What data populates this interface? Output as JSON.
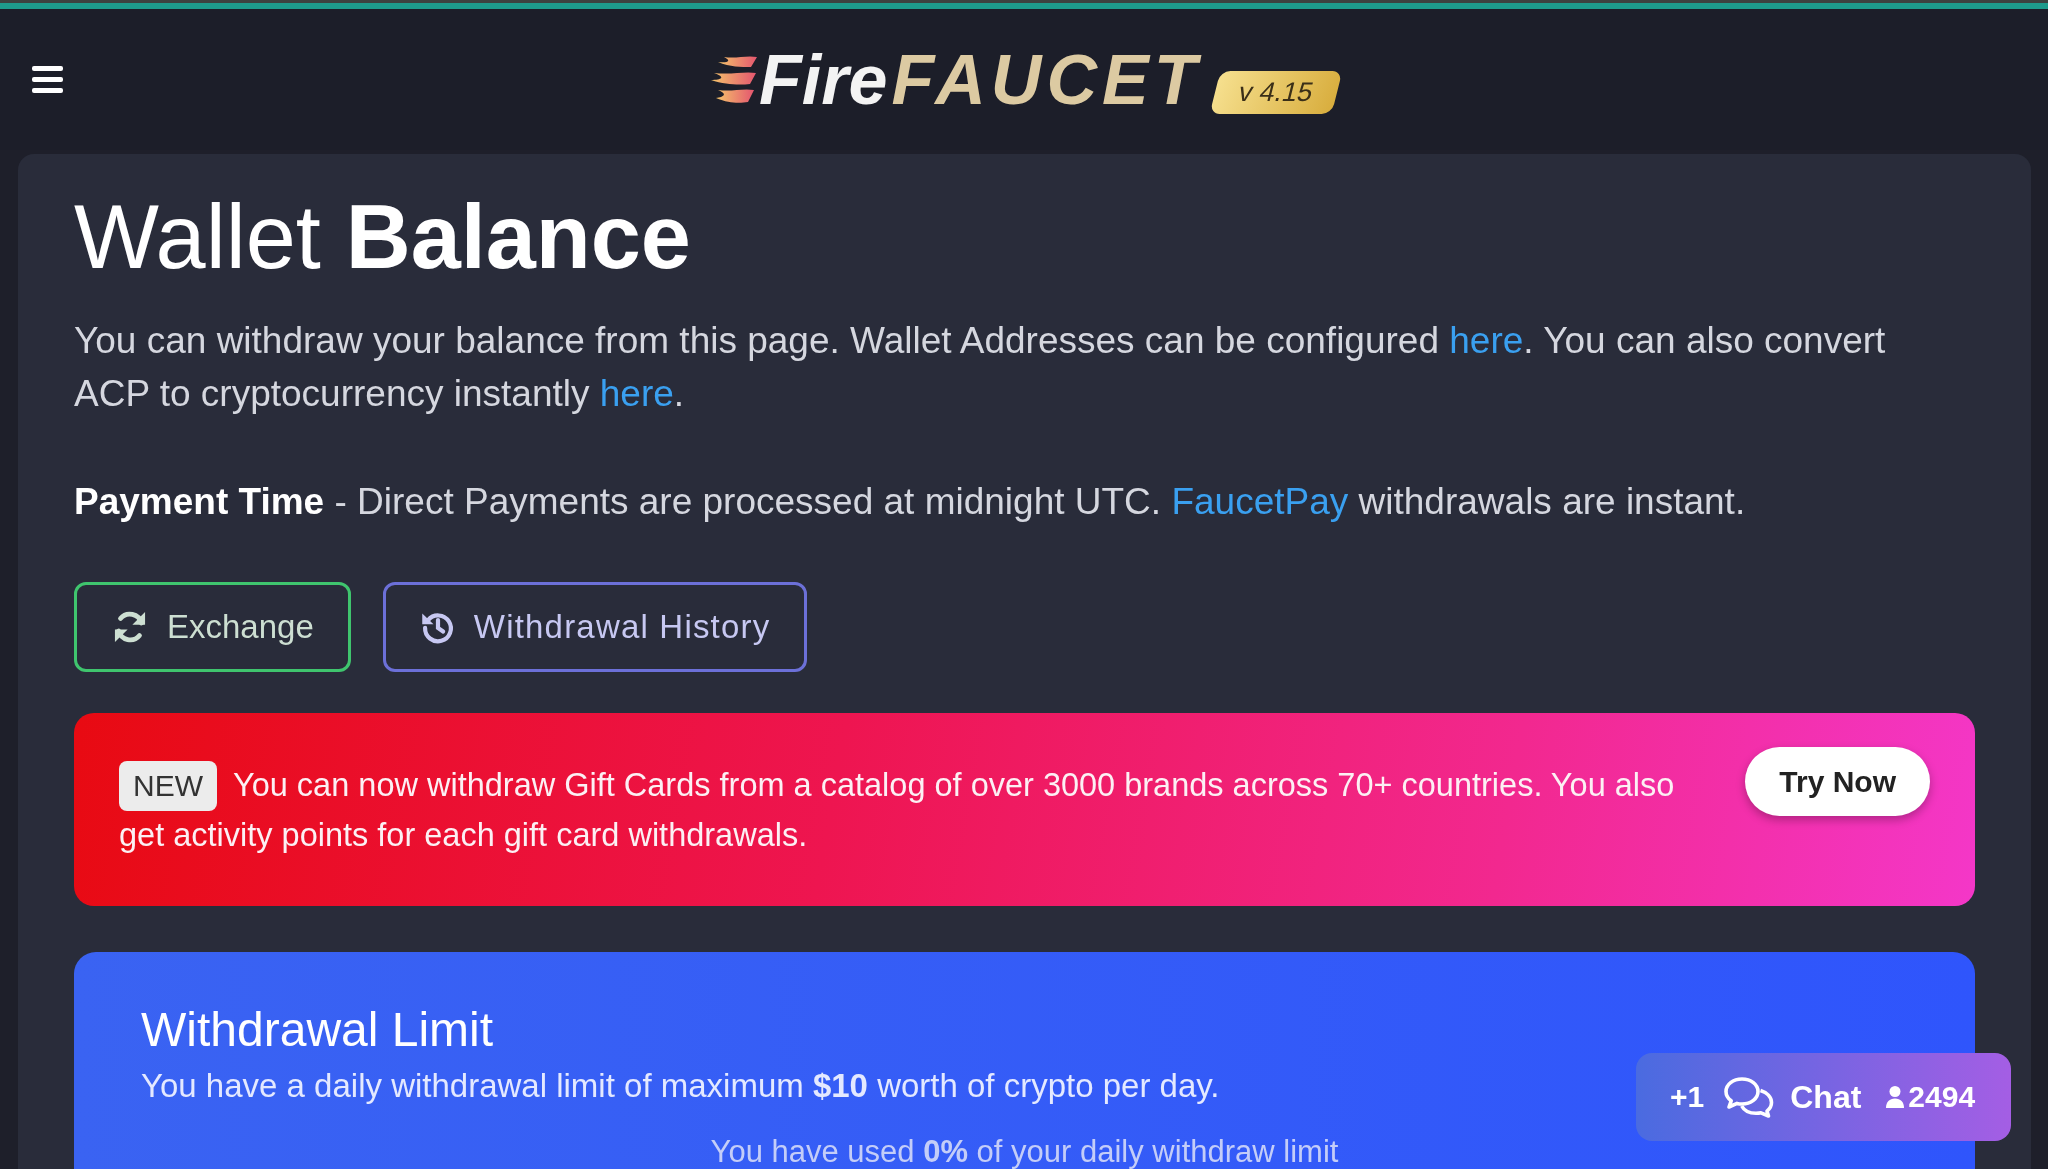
{
  "header": {
    "logo": [
      {
        "text": "Fire",
        "kind": "light"
      },
      {
        "text": "FAUCET",
        "kind": "gold"
      }
    ],
    "version": "v 4.15"
  },
  "wallet": {
    "title": "Wallet **Balance**",
    "intro": [
      {
        "kind": "text",
        "text": "You can withdraw your balance from this page. Wallet Addresses can be configured "
      },
      {
        "kind": "link",
        "text": "here"
      },
      {
        "kind": "text",
        "text": ". You can also convert ACP to cryptocurrency instantly "
      },
      {
        "kind": "link",
        "text": "here"
      },
      {
        "kind": "text",
        "text": "."
      }
    ],
    "payment": [
      {
        "kind": "text",
        "text": "**Payment Time** - Direct Payments are processed at midnight UTC. "
      },
      {
        "kind": "link",
        "text": "FaucetPay"
      },
      {
        "kind": "text",
        "text": " withdrawals are instant."
      }
    ],
    "buttons": [
      {
        "kind": "exchange",
        "label": "Exchange"
      },
      {
        "kind": "history",
        "label": "Withdrawal History"
      }
    ]
  },
  "promo": {
    "badge": "NEW",
    "text": "You can now withdraw Gift Cards from a catalog of over 3000 brands across 70+ countries. You also get activity points for each gift card withdrawals.",
    "button": "Try Now"
  },
  "withdrawal_limit": {
    "title": "Withdrawal Limit",
    "text": "You have a daily withdrawal limit of maximum **$10** worth of crypto per day.",
    "usage": "You have used **0%** of your daily withdraw limit"
  },
  "chat": {
    "unread": "+1",
    "label": "Chat",
    "online": "2494"
  }
}
